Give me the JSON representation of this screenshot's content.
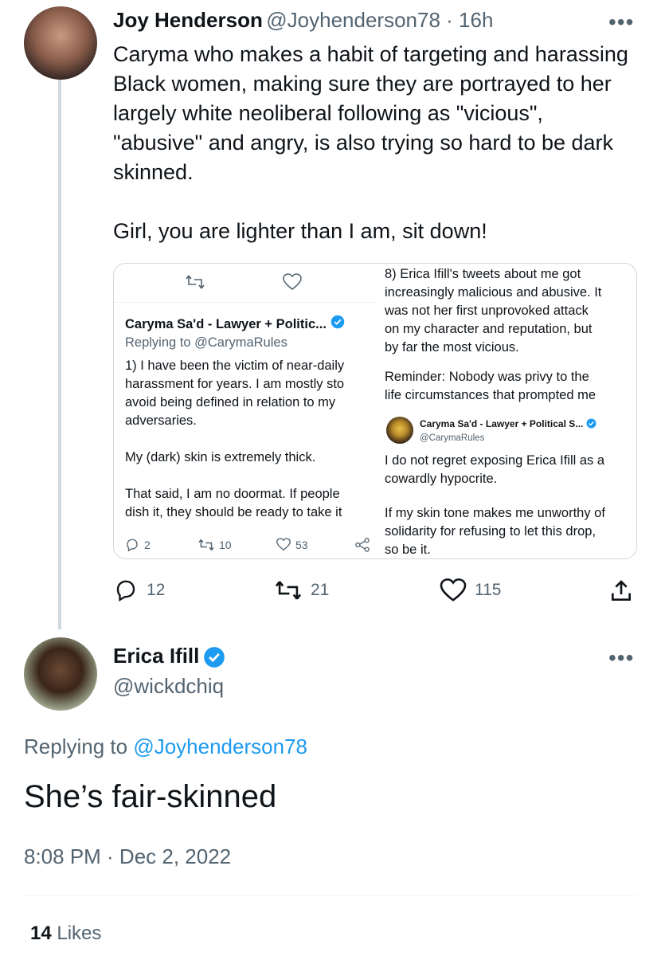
{
  "tweet1": {
    "author_name": "Joy Henderson",
    "handle_time": "@Joyhenderson78 · 16h",
    "more": "•••",
    "body_lines": [
      "Caryma who makes a habit of targeting and harassing",
      "Black women, making sure they are portrayed to her",
      "largely white neoliberal following as \"vicious\",",
      "\"abusive\" and angry, is also trying so hard to be dark",
      "skinned.",
      "",
      "Girl, you are lighter than I am, sit down!"
    ],
    "embed": {
      "left": {
        "author": "Caryma Sa'd - Lawyer + Politic...",
        "replying": "Replying to @CarymaRules",
        "text_lines": [
          "1) I have been the victim of near-daily",
          "harassment for years. I am mostly sto",
          "avoid being defined in relation to my",
          "adversaries.",
          "",
          "My (dark) skin is extremely thick.",
          "",
          "That said, I am no doormat. If people",
          "dish it, they should be ready to take it"
        ],
        "replies": "2",
        "retweets": "10",
        "likes": "53"
      },
      "right": {
        "text_lines_top": [
          "8) Erica Ifill's tweets about me got",
          "increasingly malicious and abusive. It",
          "was not her first unprovoked attack",
          "on my character and reputation, but",
          "by far the most vicious.",
          "",
          "Reminder: Nobody was privy to the",
          "life circumstances that prompted me"
        ],
        "quoted_name": "Caryma Sa'd - Lawyer + Political S...",
        "quoted_handle": "@CarymaRules",
        "text_lines_bottom": [
          "I do not regret exposing Erica Ifill as a",
          "cowardly hypocrite.",
          "",
          "If my skin tone makes me unworthy of",
          "solidarity for refusing to let this drop,",
          "so be it."
        ]
      }
    },
    "replies": "12",
    "retweets": "21",
    "likes": "115"
  },
  "tweet2": {
    "author_name": "Erica Ifill",
    "handle": "@wickdchiq",
    "more": "•••",
    "replying_prefix": "Replying to ",
    "replying_handle": "@Joyhenderson78",
    "body": "She’s fair-skinned",
    "timestamp": "8:08 PM · Dec 2, 2022",
    "likes_count": "14",
    "likes_label": " Likes"
  },
  "colors": {
    "accent": "#1d9bf0",
    "secondary": "#536471",
    "border": "#cfd9de"
  }
}
